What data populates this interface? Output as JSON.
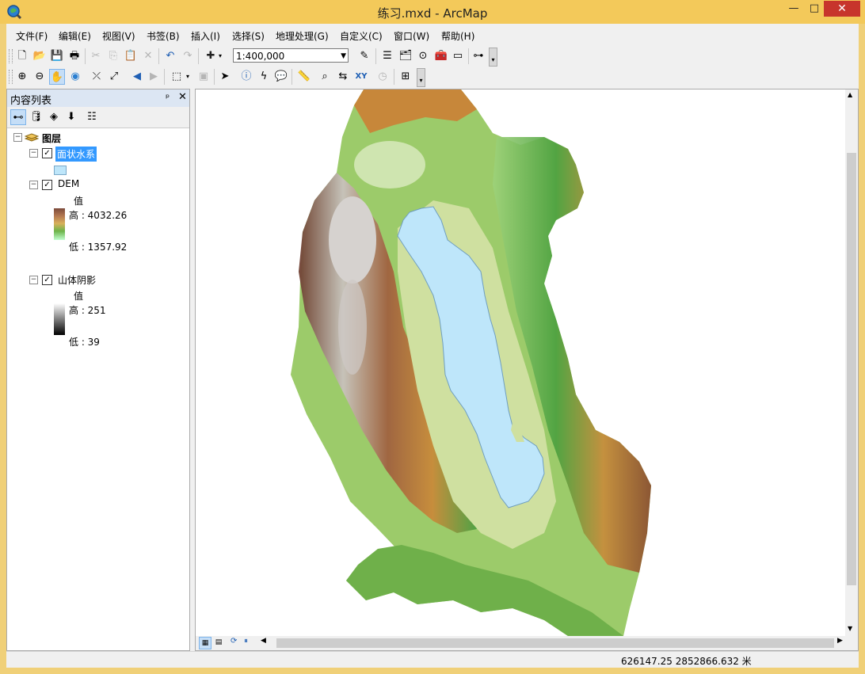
{
  "window": {
    "title": "练习.mxd - ArcMap",
    "minimize": "—",
    "maximize": "□",
    "close": "✕"
  },
  "menu": [
    "文件(F)",
    "编辑(E)",
    "视图(V)",
    "书签(B)",
    "插入(I)",
    "选择(S)",
    "地理处理(G)",
    "自定义(C)",
    "窗口(W)",
    "帮助(H)"
  ],
  "toolbar": {
    "scale": "1:400,000"
  },
  "toc": {
    "title": "内容列表",
    "pin": "ᵖ",
    "close": "✕",
    "root": "图层",
    "layers": [
      {
        "name": "面状水系",
        "checked": true,
        "selected": true
      },
      {
        "name": "DEM",
        "checked": true,
        "legend_title": "值",
        "high": "高 : 4032.26",
        "low": "低 : 1357.92"
      },
      {
        "name": "山体阴影",
        "checked": true,
        "legend_title": "值",
        "high": "高 : 251",
        "low": "低 : 39"
      }
    ]
  },
  "status": {
    "coords": "626147.25  2852866.632 米"
  },
  "colors": {
    "titlebar": "#f3c95a",
    "selection": "#3399ff",
    "water": "#bee6fa",
    "dem_high": "#7b4a3a",
    "dem_low": "#c2ffd0"
  }
}
